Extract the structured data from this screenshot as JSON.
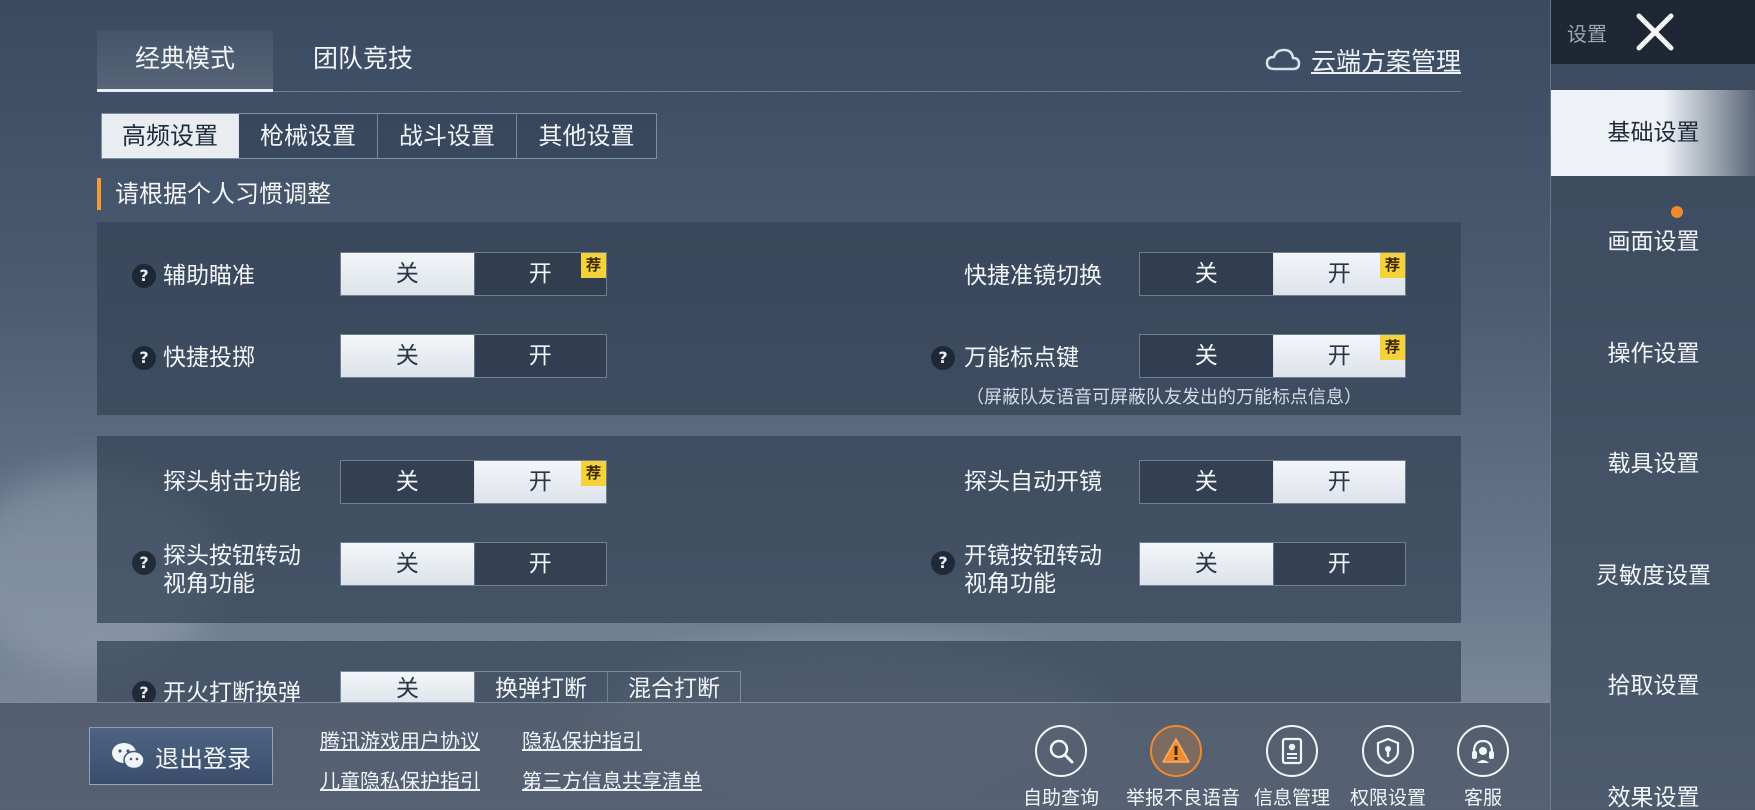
{
  "mode_tabs": [
    "经典模式",
    "团队竞技"
  ],
  "cloud_manage": "云端方案管理",
  "sub_tabs": [
    "高频设置",
    "枪械设置",
    "战斗设置",
    "其他设置"
  ],
  "hint": "请根据个人习惯调整",
  "toggle_labels": {
    "off": "关",
    "on": "开"
  },
  "recommend_badge": "荐",
  "panel1": {
    "aim_assist": {
      "label": "辅助瞄准",
      "value": "关",
      "recommended": "开"
    },
    "quick_throw": {
      "label": "快捷投掷",
      "value": "关"
    },
    "quick_scope_switch": {
      "label": "快捷准镜切换",
      "value": "开",
      "recommended": "开"
    },
    "universal_marker": {
      "label": "万能标点键",
      "value": "开",
      "recommended": "开",
      "note": "（屏蔽队友语音可屏蔽队友发出的万能标点信息）"
    }
  },
  "panel2": {
    "peek_fire": {
      "label": "探头射击功能",
      "value": "开",
      "recommended": "开"
    },
    "peek_button_rotate": {
      "label_line1": "探头按钮转动",
      "label_line2": "视角功能",
      "value": "关"
    },
    "peek_auto_scope": {
      "label": "探头自动开镜",
      "value": "开"
    },
    "scope_button_rotate": {
      "label_line1": "开镜按钮转动",
      "label_line2": "视角功能",
      "value": "关"
    }
  },
  "panel3": {
    "fire_interrupt_reload": {
      "label": "开火打断换弹",
      "options": [
        "关",
        "换弹打断",
        "混合打断"
      ],
      "value": "关"
    }
  },
  "bottom": {
    "logout": "退出登录",
    "links": [
      "腾讯游戏用户协议",
      "隐私保护指引",
      "儿童隐私保护指引",
      "第三方信息共享清单"
    ],
    "buttons": [
      "自助查询",
      "举报不良语音",
      "信息管理",
      "权限设置",
      "客服"
    ]
  },
  "sidebar": {
    "title": "设置",
    "items": [
      "基础设置",
      "画面设置",
      "操作设置",
      "载具设置",
      "灵敏度设置",
      "拾取设置",
      "效果设置"
    ],
    "active": "基础设置"
  },
  "colors": {
    "accent_orange": "#f39a3a",
    "badge_yellow": "#f5d13a",
    "selected_option": "#e9edf1"
  }
}
